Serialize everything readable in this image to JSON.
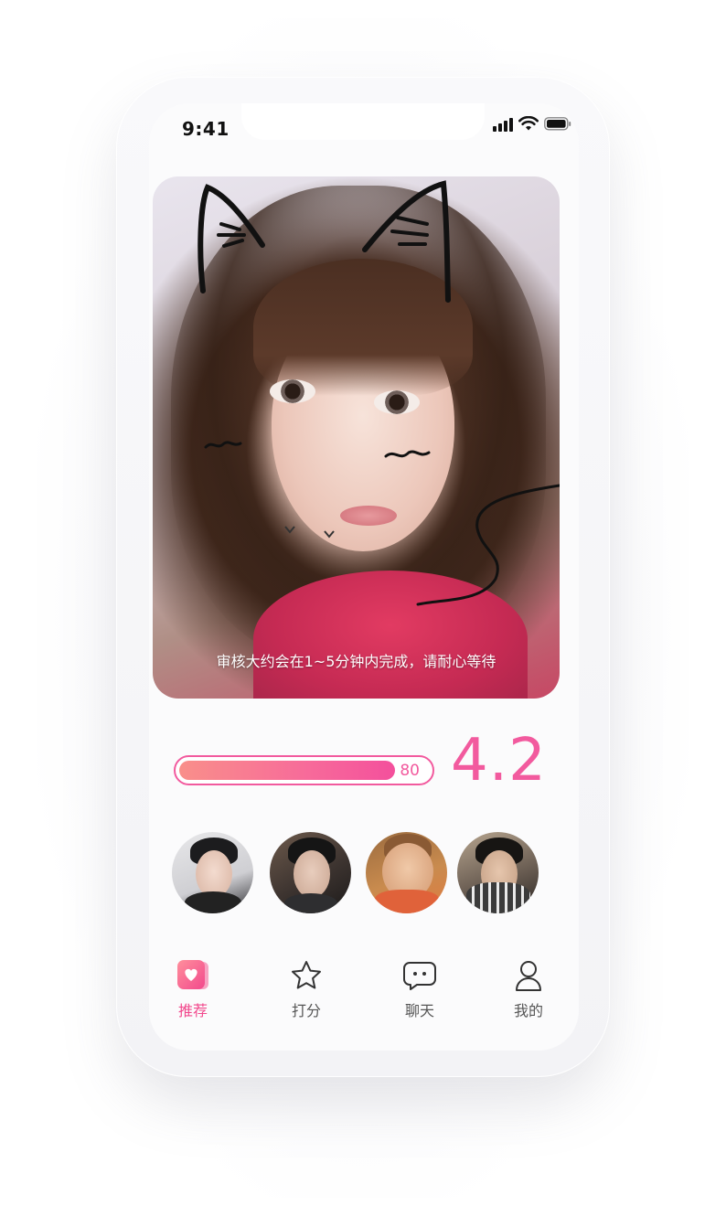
{
  "status_bar": {
    "time": "9:41"
  },
  "photo": {
    "caption": "审核大约会在1~5分钟内完成，请耐心等待"
  },
  "score": {
    "bar_value": 80,
    "bar_fraction": 0.8,
    "rating": "4.2"
  },
  "avatars": [
    {
      "name": "avatar-1"
    },
    {
      "name": "avatar-2"
    },
    {
      "name": "avatar-3"
    },
    {
      "name": "avatar-4"
    }
  ],
  "tabs": [
    {
      "label": "推荐",
      "icon": "cards-heart-icon",
      "active": true
    },
    {
      "label": "打分",
      "icon": "star-icon",
      "active": false
    },
    {
      "label": "聊天",
      "icon": "chat-bubble-icon",
      "active": false
    },
    {
      "label": "我的",
      "icon": "user-icon",
      "active": false
    }
  ],
  "colors": {
    "accent": "#f25a9e",
    "accent_gradient_start": "#f98f8a"
  }
}
